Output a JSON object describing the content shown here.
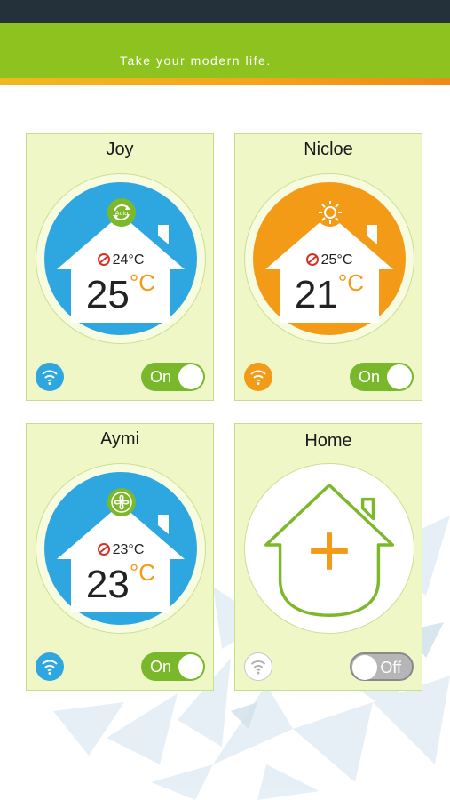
{
  "header": {
    "tagline": "Take your modern life."
  },
  "colors": {
    "green": "#8dc21f",
    "blue": "#2ea7e0",
    "orange": "#f39a16",
    "grey": "#b6b6b6"
  },
  "devices": [
    {
      "name": "Joy",
      "mode_icon": "auto-mode-icon",
      "mode_label": "Auto",
      "set_temp": "24°C",
      "current_temp": "25",
      "unit": "°C",
      "color": "#2ea7e0",
      "toggle": "On"
    },
    {
      "name": "Nicloe",
      "mode_icon": "heat-sun-icon",
      "set_temp": "25°C",
      "current_temp": "21",
      "unit": "°C",
      "color": "#f39a16",
      "toggle": "On"
    },
    {
      "name": "Aymi",
      "mode_icon": "fan-icon",
      "set_temp": "23°C",
      "current_temp": "23",
      "unit": "°C",
      "color": "#2ea7e0",
      "toggle": "On"
    },
    {
      "name": "Home",
      "add_icon": "add-device-plus-icon",
      "toggle": "Off"
    }
  ]
}
